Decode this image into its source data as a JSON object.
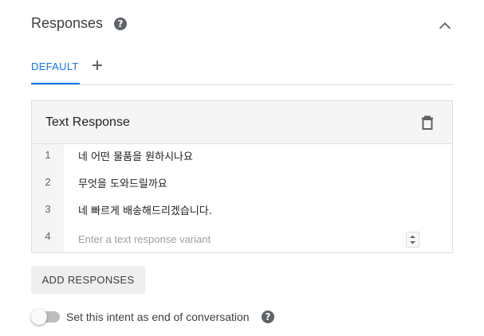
{
  "section": {
    "title": "Responses",
    "help_icon": "question-circle-icon",
    "collapse_icon": "chevron-up-icon"
  },
  "tabs": {
    "default_label": "DEFAULT",
    "add_icon": "plus-icon",
    "active_color": "#1a73e8"
  },
  "card": {
    "title": "Text Response",
    "delete_icon": "trash-icon",
    "rows": [
      {
        "number": "1",
        "text": "네 어떤 물품을 원하시나요"
      },
      {
        "number": "2",
        "text": "무엇을 도와드릴까요"
      },
      {
        "number": "3",
        "text": "네 빠르게 배송해드리겠습니다."
      },
      {
        "number": "4",
        "placeholder": "Enter a text response variant"
      }
    ]
  },
  "add_button_label": "ADD RESPONSES",
  "end_conversation": {
    "label": "Set this intent as end of conversation",
    "enabled": false,
    "help_icon": "question-circle-icon"
  }
}
